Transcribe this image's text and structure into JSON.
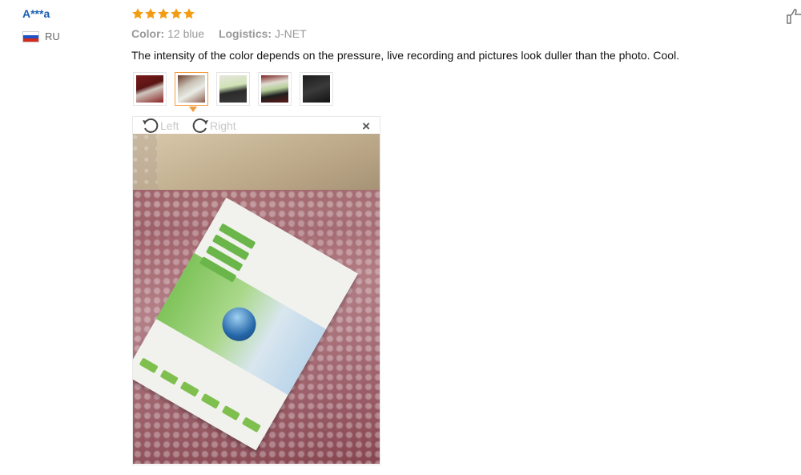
{
  "reviewer": {
    "name": "A***a",
    "country_code": "RU"
  },
  "rating": {
    "stars": 5,
    "max": 5,
    "star_color": "#f39c12"
  },
  "meta": {
    "color_label": "Color:",
    "color_value": "12 blue",
    "logistics_label": "Logistics:",
    "logistics_value": "J-NET"
  },
  "review_text": "The intensity of the color depends on the pressure, live recording and pictures look duller than the photo. Cool.",
  "thumbnails": {
    "count": 5,
    "active_index": 1,
    "active_color": "#f39c3f"
  },
  "viewer": {
    "rotate_left_label": "Left",
    "rotate_right_label": "Right",
    "close_label": "×"
  },
  "icons": {
    "like": "thumbs-up-icon",
    "rotate_left": "rotate-left-icon",
    "rotate_right": "rotate-right-icon",
    "close": "close-icon",
    "flag": "russia-flag-icon",
    "star": "star-icon"
  },
  "colors": {
    "reviewer_name": "#1a5fb4",
    "review_text": "#111111",
    "meta_text": "#999999"
  }
}
